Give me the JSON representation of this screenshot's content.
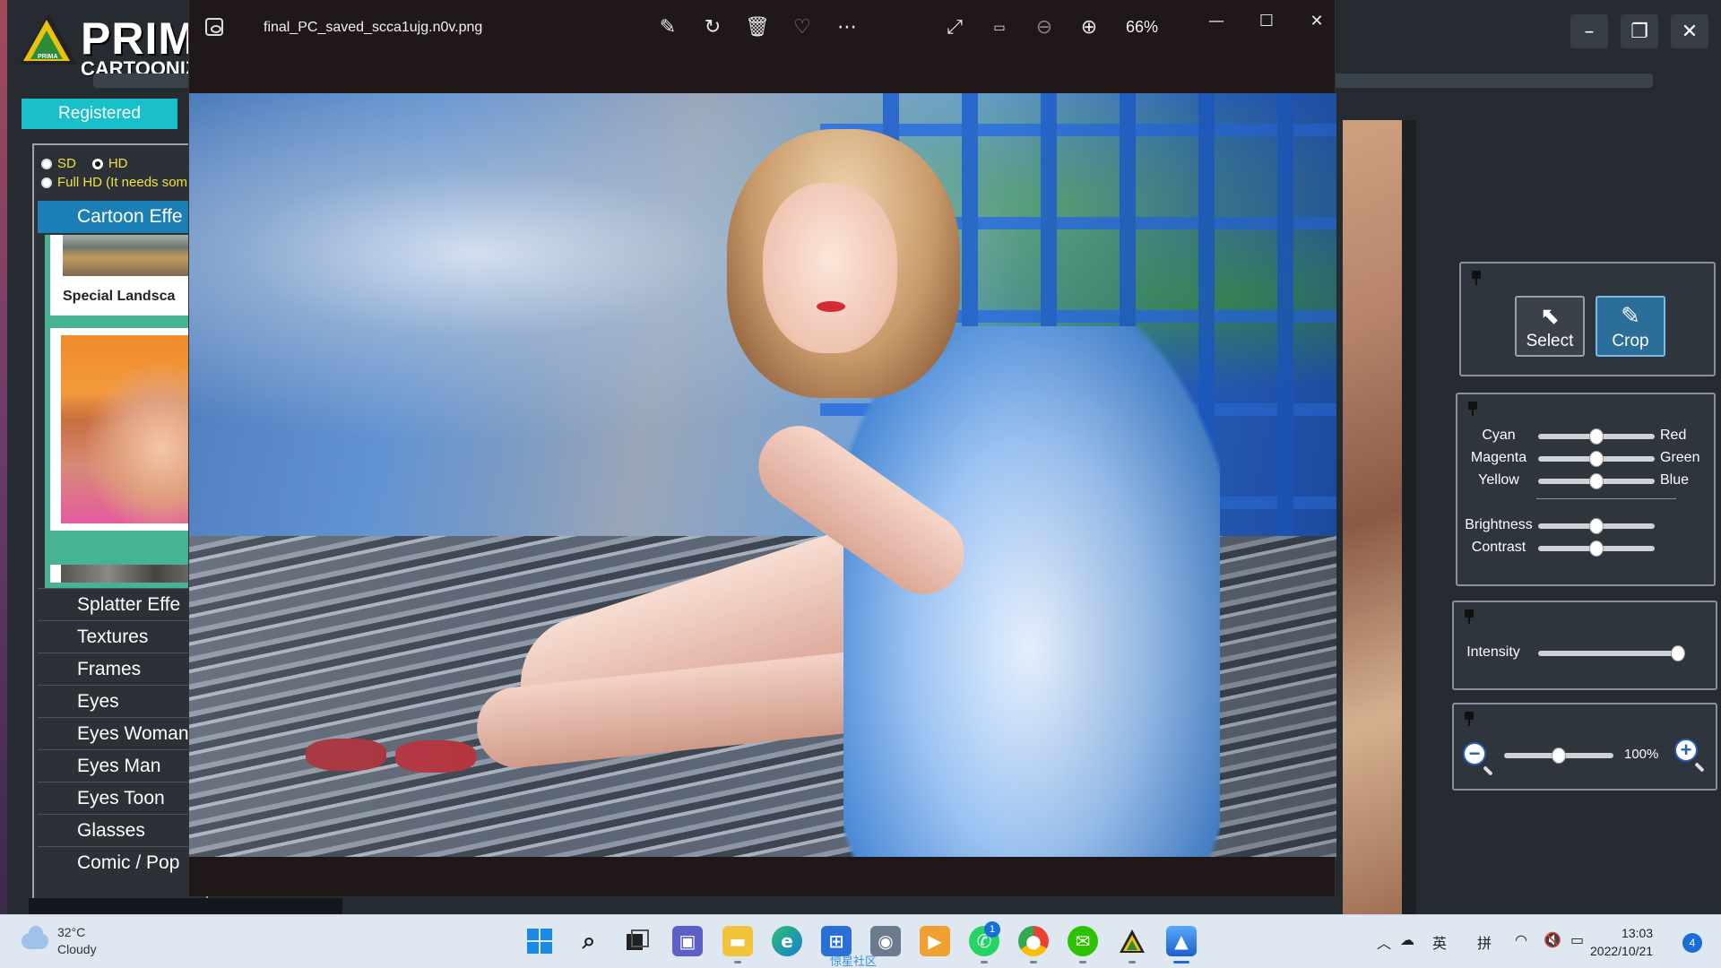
{
  "prima": {
    "logo_text": "PRIMA",
    "logo_sub": "CARTOONIZER",
    "logo_small": "PRIMA",
    "registered": "Registered",
    "resolution": {
      "sd": "SD",
      "hd": "HD",
      "fullhd": "Full HD (It needs som",
      "selected": "HD"
    },
    "active_category": "Cartoon Effe",
    "thumbnails": [
      "Special Landsca"
    ],
    "categories": [
      "Splatter Effe",
      "Textures",
      "Frames",
      "Eyes",
      "Eyes Woman",
      "Eyes Man",
      "Eyes Toon",
      "Glasses",
      "Comic / Pop"
    ],
    "tools": {
      "select": "Select",
      "crop": "Crop"
    },
    "color": {
      "rows": [
        {
          "left": "Cyan",
          "right": "Red",
          "value": 0.5
        },
        {
          "left": "Magenta",
          "right": "Green",
          "value": 0.5
        },
        {
          "left": "Yellow",
          "right": "Blue",
          "value": 0.5
        }
      ],
      "brightness": {
        "label": "Brightness",
        "value": 0.5
      },
      "contrast": {
        "label": "Contrast",
        "value": 0.5
      }
    },
    "intensity": {
      "label": "Intensity",
      "value": 1.0
    },
    "zoom": {
      "label": "100%",
      "value": 0.5
    },
    "window_controls": {
      "minimize": "–",
      "restore": "❐",
      "close": "✕"
    }
  },
  "viewer": {
    "filename": "final_PC_saved_scca1ujg.n0v.png",
    "zoom_level": "66%",
    "toolbar_icons": [
      "edit-image-icon",
      "rotate-icon",
      "delete-icon",
      "favorite-icon",
      "more-icon"
    ],
    "view_icons": [
      "fullscreen-icon",
      "actual-size-icon",
      "zoom-out-icon",
      "zoom-in-icon"
    ],
    "window_controls": {
      "minimize": "—",
      "maximize": "☐",
      "close": "✕"
    }
  },
  "taskbar": {
    "weather": {
      "temp": "32°C",
      "condition": "Cloudy"
    },
    "apps": [
      "start",
      "search",
      "task-view",
      "teams",
      "file-explorer",
      "edge",
      "store",
      "camera",
      "media-player",
      "whatsapp",
      "chrome",
      "wechat",
      "prima-cartoonizer",
      "photos"
    ],
    "whatsapp_badge": "1",
    "watermark": "惊星社区",
    "tray": {
      "ime1": "英",
      "ime2": "拼"
    },
    "clock": {
      "time": "13:03",
      "date": "2022/10/21"
    },
    "notifications": "4"
  }
}
